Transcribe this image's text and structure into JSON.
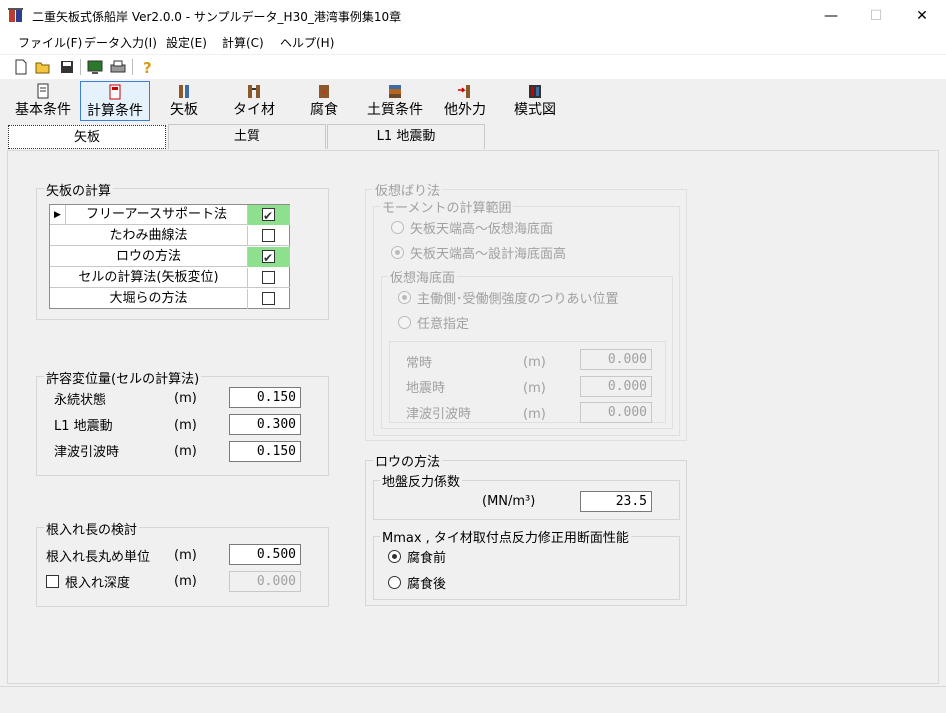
{
  "window": {
    "title": "二重矢板式係船岸 Ver2.0.0 - サンプルデータ_H30_港湾事例集10章",
    "minimize": "—",
    "maximize": "☐",
    "close": "✕"
  },
  "menu": [
    "ファイル(F)",
    "データ入力(I)",
    "設定(E)",
    "計算(C)",
    "ヘルプ(H)"
  ],
  "toolbar_icons": [
    "new-file-icon",
    "open-folder-icon",
    "save-icon",
    "monitor-icon",
    "print-icon",
    "help-icon"
  ],
  "big_toolbar": [
    {
      "label": "基本条件",
      "icon": "basic-conditions-icon"
    },
    {
      "label": "計算条件",
      "icon": "calc-conditions-icon",
      "active": true
    },
    {
      "label": "矢板",
      "icon": "sheet-pile-icon"
    },
    {
      "label": "タイ材",
      "icon": "tie-rod-icon"
    },
    {
      "label": "腐食",
      "icon": "corrosion-icon"
    },
    {
      "label": "土質条件",
      "icon": "soil-conditions-icon"
    },
    {
      "label": "他外力",
      "icon": "external-force-icon"
    },
    {
      "label": "模式図",
      "icon": "schematic-icon"
    }
  ],
  "tabs": [
    "矢板",
    "土質",
    "L1 地震動"
  ],
  "sheetpile_calc": {
    "legend": "矢板の計算",
    "rows": [
      {
        "label": "フリーアースサポート法",
        "checked": true
      },
      {
        "label": "たわみ曲線法",
        "checked": false
      },
      {
        "label": "ロウの方法",
        "checked": true
      },
      {
        "label": "セルの計算法(矢板変位)",
        "checked": false
      },
      {
        "label": "大堀らの方法",
        "checked": false
      }
    ]
  },
  "allowable_disp": {
    "legend": "許容変位量(セルの計算法)",
    "rows": [
      {
        "label": "永続状態",
        "unit": "(m)",
        "value": "0.150"
      },
      {
        "label": "L1 地震動",
        "unit": "(m)",
        "value": "0.300"
      },
      {
        "label": "津波引波時",
        "unit": "(m)",
        "value": "0.150"
      }
    ]
  },
  "embed_check": {
    "legend": "根入れ長の検討",
    "round_label": "根入れ長丸め単位",
    "round_unit": "(m)",
    "round_value": "0.500",
    "depth_label": "根入れ深度",
    "depth_unit": "(m)",
    "depth_value": "0.000"
  },
  "virtual_beam": {
    "legend": "仮想ばり法",
    "moment_legend": "モーメントの計算範囲",
    "opt1": "矢板天端高～仮想海底面",
    "opt2": "矢板天端高～設計海底面高",
    "seabed_legend": "仮想海底面",
    "sb_opt1": "主働側･受働側強度のつりあい位置",
    "sb_opt2": "任意指定",
    "rows": [
      {
        "label": "常時",
        "unit": "(m)",
        "value": "0.000"
      },
      {
        "label": "地震時",
        "unit": "(m)",
        "value": "0.000"
      },
      {
        "label": "津波引波時",
        "unit": "(m)",
        "value": "0.000"
      }
    ]
  },
  "rowe": {
    "legend": "ロウの方法",
    "ground_legend": "地盤反力係数",
    "ground_unit": "(MN/m³)",
    "ground_value": "23.5",
    "mmax_legend": "Mmax , タイ材取付点反力修正用断面性能",
    "opt1": "腐食前",
    "opt2": "腐食後"
  }
}
